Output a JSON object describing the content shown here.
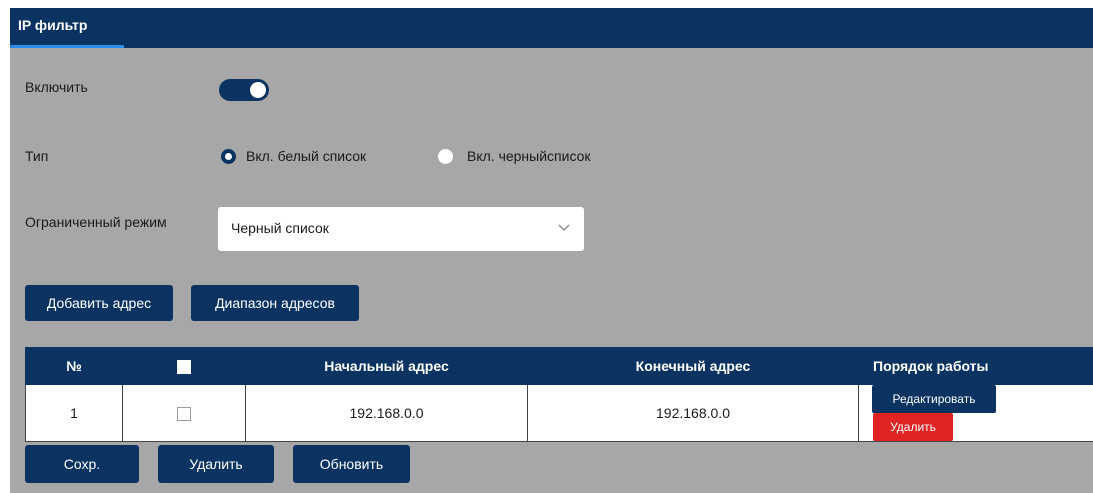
{
  "tab": {
    "label": "IP фильтр"
  },
  "enable": {
    "label": "Включить",
    "state": "on"
  },
  "type": {
    "label": "Тип",
    "options": [
      {
        "label": "Вкл. белый список",
        "selected": true
      },
      {
        "label": "Вкл. черныйсписок",
        "selected": false
      }
    ]
  },
  "restricted_mode": {
    "label": "Ограниченный режим",
    "value": "Черный список"
  },
  "actions": {
    "add_address": "Добавить адрес",
    "address_range": "Диапазон адресов"
  },
  "table": {
    "columns": [
      "№",
      "",
      "Начальный адрес",
      "Конечный адрес",
      "Порядок работы"
    ],
    "rows": [
      {
        "num": "1",
        "start": "192.168.0.0",
        "end": "192.168.0.0",
        "edit": "Редактировать",
        "delete": "Удалить"
      }
    ]
  },
  "footer": {
    "save": "Сохр.",
    "delete": "Удалить",
    "refresh": "Обновить"
  },
  "colors": {
    "primary": "#0b3362",
    "panel": "#a7a7a7",
    "danger": "#e02424",
    "tab_accent": "#2e8be6"
  }
}
